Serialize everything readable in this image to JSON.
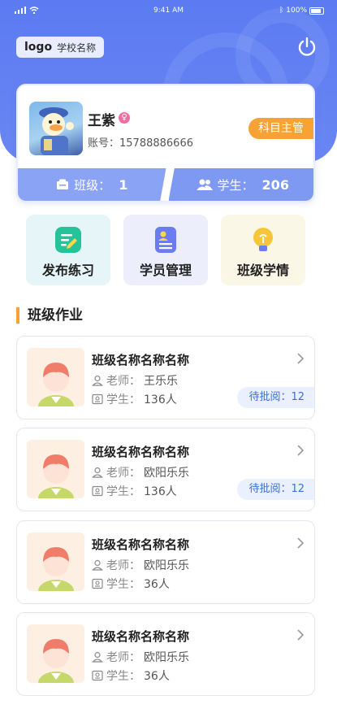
{
  "status_bar": {
    "time": "9:41 AM",
    "battery": "100%"
  },
  "header": {
    "logo_text": "logo",
    "school_name": "学校名称"
  },
  "profile": {
    "name": "王紫",
    "gender_symbol": "♀",
    "account_label": "账号：",
    "account": "15788886666",
    "role": "科目主管",
    "class_label": "班级：",
    "class_count": "1",
    "student_label": "学生：",
    "student_count": "206"
  },
  "quick_actions": [
    {
      "label": "发布练习",
      "icon": "publish-icon",
      "bg": "#e6f6f8",
      "color": "#25c39a"
    },
    {
      "label": "学员管理",
      "icon": "student-card-icon",
      "bg": "#eceefc",
      "color": "#6a7cf0"
    },
    {
      "label": "班级学情",
      "icon": "bulb-icon",
      "bg": "#fbf7e6",
      "color": "#f6c53a"
    }
  ],
  "section": {
    "title": "班级作业"
  },
  "homework": [
    {
      "class_name": "班级名称名称名称",
      "teacher_label": "老师：",
      "teacher": "王乐乐",
      "student_label": "学生：",
      "students": "136人",
      "pending": "待批阅：12"
    },
    {
      "class_name": "班级名称名称名称",
      "teacher_label": "老师：",
      "teacher": "欧阳乐乐",
      "student_label": "学生：",
      "students": "136人",
      "pending": "待批阅：12"
    },
    {
      "class_name": "班级名称名称名称",
      "teacher_label": "老师：",
      "teacher": "欧阳乐乐",
      "student_label": "学生：",
      "students": "36人",
      "pending": ""
    },
    {
      "class_name": "班级名称名称名称",
      "teacher_label": "老师：",
      "teacher": "欧阳乐乐",
      "student_label": "学生：",
      "students": "36人",
      "pending": ""
    }
  ],
  "colors": {
    "primary": "#5b7bf2",
    "accent": "#f7a234",
    "pending_text": "#3c6fd8"
  }
}
